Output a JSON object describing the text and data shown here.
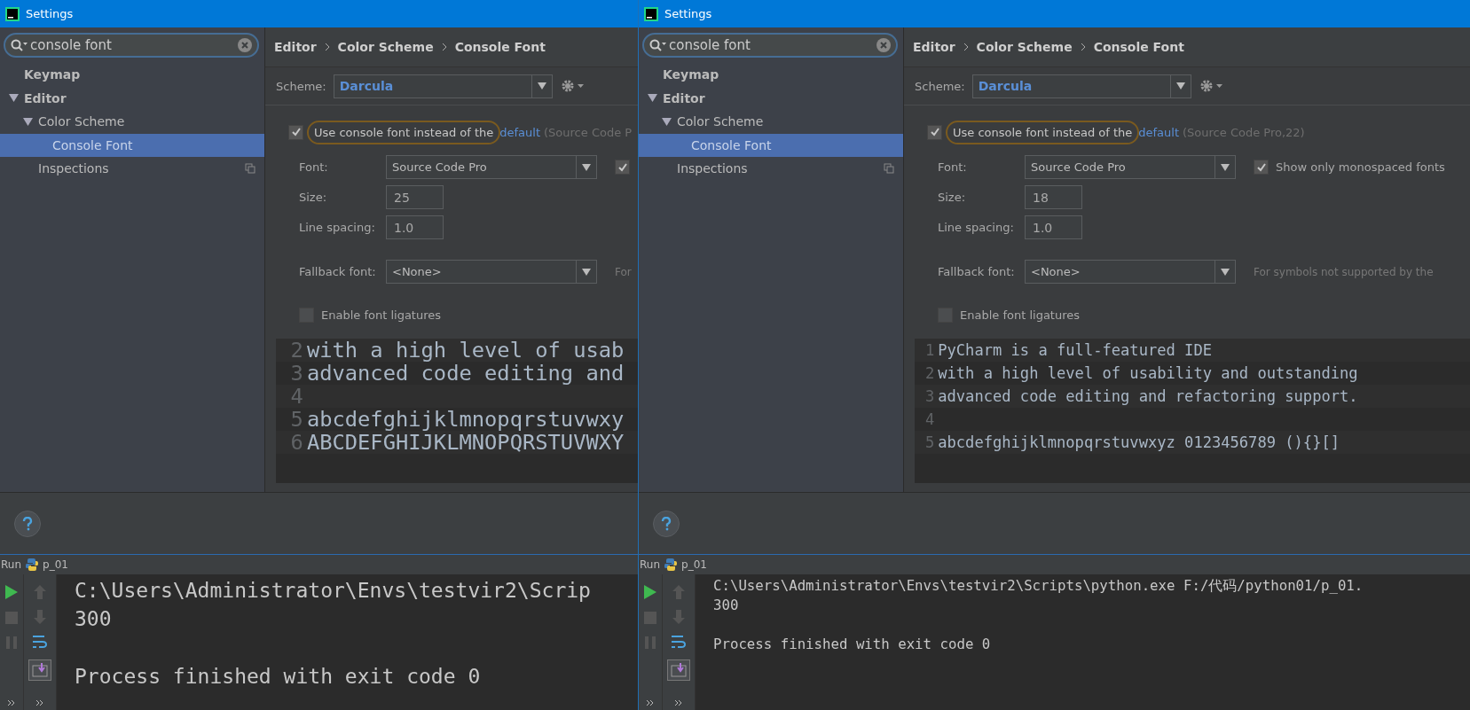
{
  "windows": [
    {
      "title": "Settings",
      "search": {
        "value": "console font"
      },
      "tree": [
        {
          "label": "Keymap",
          "selected": false,
          "scope_icon": false
        },
        {
          "label": "Editor",
          "selected": false,
          "expanded": true,
          "scope_icon": false,
          "children": [
            {
              "label": "Color Scheme",
              "selected": false,
              "expanded": true,
              "scope_icon": false,
              "children": [
                {
                  "label": "Console Font",
                  "selected": true,
                  "scope_icon": false
                }
              ]
            },
            {
              "label": "Inspections",
              "selected": false,
              "scope_icon": true
            }
          ]
        }
      ],
      "breadcrumb": [
        "Editor",
        "Color Scheme",
        "Console Font"
      ],
      "scheme": {
        "label": "Scheme:",
        "value": "Darcula"
      },
      "use_console_font": {
        "checked": true,
        "focused": true,
        "label": "Use console font instead of the",
        "link": "default",
        "note": "(Source Code P"
      },
      "font": {
        "label": "Font:",
        "value": "Source Code Pro"
      },
      "show_mono": {
        "checked": true
      },
      "size": {
        "label": "Size:",
        "value": "25"
      },
      "line_spacing": {
        "label": "Line spacing:",
        "value": "1.0"
      },
      "fallback": {
        "label": "Fallback font:",
        "value": "<None>",
        "hint": "For"
      },
      "ligatures": {
        "checked": false,
        "label": "Enable font ligatures"
      },
      "preview": [
        {
          "number": "2",
          "text": "with a high level of usab"
        },
        {
          "number": "3",
          "text": "advanced code editing and"
        },
        {
          "number": "4"
        },
        {
          "number": "5",
          "text": "abcdefghijklmnopqrstuvwxy"
        },
        {
          "number": "6",
          "text": "ABCDEFGHIJKLMNOPQRSTUVWXY"
        }
      ],
      "run": {
        "label": "Run",
        "config": "p_01",
        "command": "C:\\Users\\Administrator\\Envs\\testvir2\\Scrip",
        "result": "300",
        "status": "Process finished with exit code 0"
      }
    },
    {
      "title": "Settings",
      "search": {
        "value": "console font"
      },
      "tree": [
        {
          "label": "Keymap",
          "selected": false,
          "scope_icon": false
        },
        {
          "label": "Editor",
          "selected": false,
          "expanded": true,
          "scope_icon": false,
          "children": [
            {
              "label": "Color Scheme",
              "selected": false,
              "expanded": true,
              "scope_icon": false,
              "children": [
                {
                  "label": "Console Font",
                  "selected": true,
                  "scope_icon": false
                }
              ]
            },
            {
              "label": "Inspections",
              "selected": false,
              "scope_icon": true
            }
          ]
        }
      ],
      "breadcrumb": [
        "Editor",
        "Color Scheme",
        "Console Font"
      ],
      "scheme": {
        "label": "Scheme:",
        "value": "Darcula"
      },
      "use_console_font": {
        "checked": true,
        "focused": true,
        "label": "Use console font instead of the",
        "link": "default",
        "note": "(Source Code Pro,22)"
      },
      "font": {
        "label": "Font:",
        "value": "Source Code Pro"
      },
      "show_mono": {
        "checked": true,
        "label": "Show only monospaced fonts"
      },
      "size": {
        "label": "Size:",
        "value": "18"
      },
      "line_spacing": {
        "label": "Line spacing:",
        "value": "1.0"
      },
      "fallback": {
        "label": "Fallback font:",
        "value": "<None>",
        "hint": "For symbols not supported by the"
      },
      "ligatures": {
        "checked": false,
        "label": "Enable font ligatures"
      },
      "preview": [
        {
          "number": "1",
          "text": "PyCharm is a full-featured IDE"
        },
        {
          "number": "2",
          "text": "with a high level of usability and outstanding"
        },
        {
          "number": "3",
          "text": "advanced code editing and refactoring support."
        },
        {
          "number": "4"
        },
        {
          "number": "5",
          "text": "abcdefghijklmnopqrstuvwxyz 0123456789 (){}[]"
        }
      ],
      "run": {
        "label": "Run",
        "config": "p_01",
        "command": "C:\\Users\\Administrator\\Envs\\testvir2\\Scripts\\python.exe F:/代码/python01/p_01.",
        "result": "300",
        "status": "Process finished with exit code 0"
      }
    }
  ]
}
